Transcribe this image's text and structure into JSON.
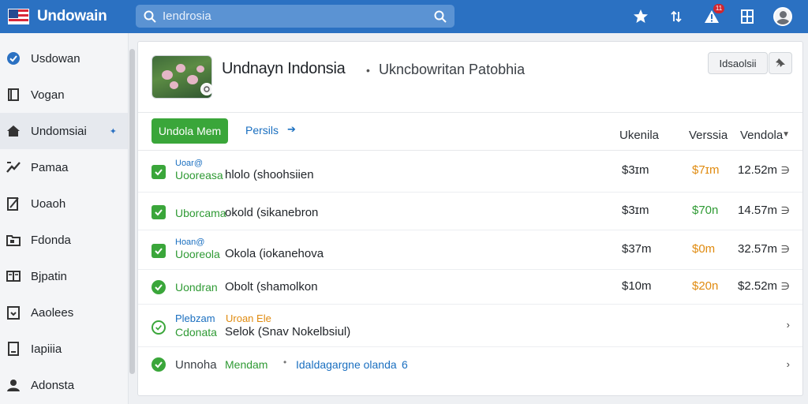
{
  "app": {
    "brand": "Undowain",
    "colors": {
      "topbar": "#2b71c2",
      "accent_green": "#3aa63a",
      "link_blue": "#1a6fc0",
      "amber": "#e08b10"
    }
  },
  "search": {
    "value": "",
    "placeholder": "Iendrosia"
  },
  "topbar": {
    "icons": [
      "star-icon",
      "sort-icon",
      "alert-icon",
      "grid-icon",
      "avatar"
    ],
    "notification_count": "11"
  },
  "sidebar": {
    "items": [
      {
        "label": "Usdowan",
        "icon": "check-circle-icon"
      },
      {
        "label": "Vogan",
        "icon": "bookmark-icon"
      },
      {
        "label": "Undomsiai",
        "icon": "home-icon",
        "active": true
      },
      {
        "label": "Pamaa",
        "icon": "chart-icon"
      },
      {
        "label": "Uoaoh",
        "icon": "edit-icon"
      },
      {
        "label": "Fdonda",
        "icon": "folder-icon"
      },
      {
        "label": "Bjpatin",
        "icon": "columns-icon"
      },
      {
        "label": "Aaolees",
        "icon": "download-icon"
      },
      {
        "label": "Iapiiia",
        "icon": "document-icon"
      },
      {
        "label": "Adonsta",
        "icon": "person-icon"
      }
    ]
  },
  "header": {
    "title": "Undnayn Indonsia",
    "separator": "•",
    "subtitle": "Ukncbowritan Patobhia",
    "button_label": "Idsaolsii"
  },
  "toolbar": {
    "primary_label": "Undola Mem",
    "link_label": "Persils",
    "columns": [
      "Ukenila",
      "Verssia",
      "Vendola"
    ]
  },
  "rows": [
    {
      "label_top": "Uoar@",
      "tag": "Uooreasa",
      "description": "hlolo (shoohsiien",
      "v1": "$3ɪm",
      "v2": "$7ɪm",
      "v3": "12.52m"
    },
    {
      "label_top": "",
      "tag": "Uborcama",
      "description": "okold (sikanebron",
      "v1": "$3ɪm",
      "v2": "$70n",
      "v3": "14.57m"
    },
    {
      "label_top": "Hoan@",
      "tag": "Uooreola",
      "description": "Okola (iokanehova",
      "v1": "$37m",
      "v2": "$0m",
      "v3": "32.57m"
    },
    {
      "label_top": "",
      "tag": "Uondran",
      "description": "Obolt (shamolkon",
      "v1": "$10m",
      "v2": "$20n",
      "v3": "$2.52m"
    },
    {
      "label_top": "Plebzam",
      "label_top_tag": "Uroan Ele",
      "tag": "Cdonata",
      "description": "Selok (Snav Nokelbsiul)"
    },
    {
      "tag_first": "Unnoha",
      "tag": "Mendam",
      "dot": "•",
      "link": "Idaldagargne olanda",
      "suffix": "6"
    }
  ]
}
